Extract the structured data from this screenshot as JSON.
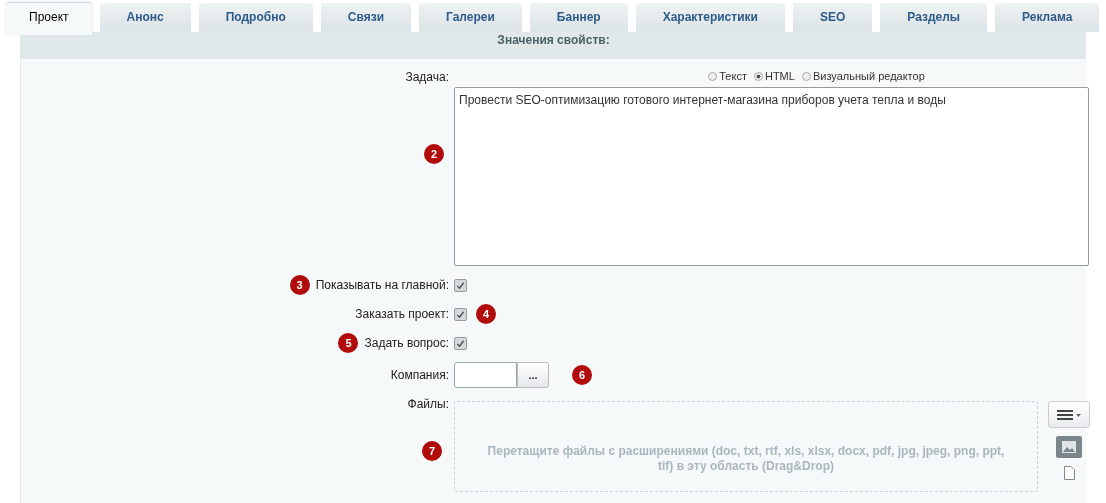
{
  "tabs": [
    {
      "label": "Проект",
      "selected": true
    },
    {
      "label": "Анонс",
      "selected": false
    },
    {
      "label": "Подробно",
      "selected": false
    },
    {
      "label": "Связи",
      "selected": false
    },
    {
      "label": "Галереи",
      "selected": false
    },
    {
      "label": "Баннер",
      "selected": false
    },
    {
      "label": "Характеристики",
      "selected": false
    },
    {
      "label": "SEO",
      "selected": false
    },
    {
      "label": "Разделы",
      "selected": false
    },
    {
      "label": "Реклама",
      "selected": false
    }
  ],
  "section_title": "Значения свойств:",
  "fields": [
    {
      "kind": "editor",
      "label": "Задача:",
      "badge_below": "2",
      "modes": [
        {
          "label": "Текст",
          "selected": false
        },
        {
          "label": "HTML",
          "selected": true
        },
        {
          "label": "Визуальный редактор",
          "selected": false
        }
      ],
      "value": "Провести SEO-оптимизацию готового интернет-магазина приборов учета тепла и воды"
    },
    {
      "kind": "checkbox",
      "label": "Показывать на главной:",
      "checked": true,
      "badge_before": "3"
    },
    {
      "kind": "checkbox",
      "label": "Заказать проект:",
      "checked": true,
      "badge_after": "4"
    },
    {
      "kind": "checkbox",
      "label": "Задать вопрос:",
      "checked": true,
      "badge_before": "5"
    },
    {
      "kind": "lookup",
      "label": "Компания:",
      "button": "...",
      "badge_after": "6"
    },
    {
      "kind": "files",
      "label": "Файлы:",
      "badge_below": "7",
      "hint": "Перетащите файлы с расширениями (doc, txt, rtf, xls, xlsx, docx, pdf, jpg, jpeg, png, ppt, tif) в эту область (Drag&Drop)"
    }
  ]
}
